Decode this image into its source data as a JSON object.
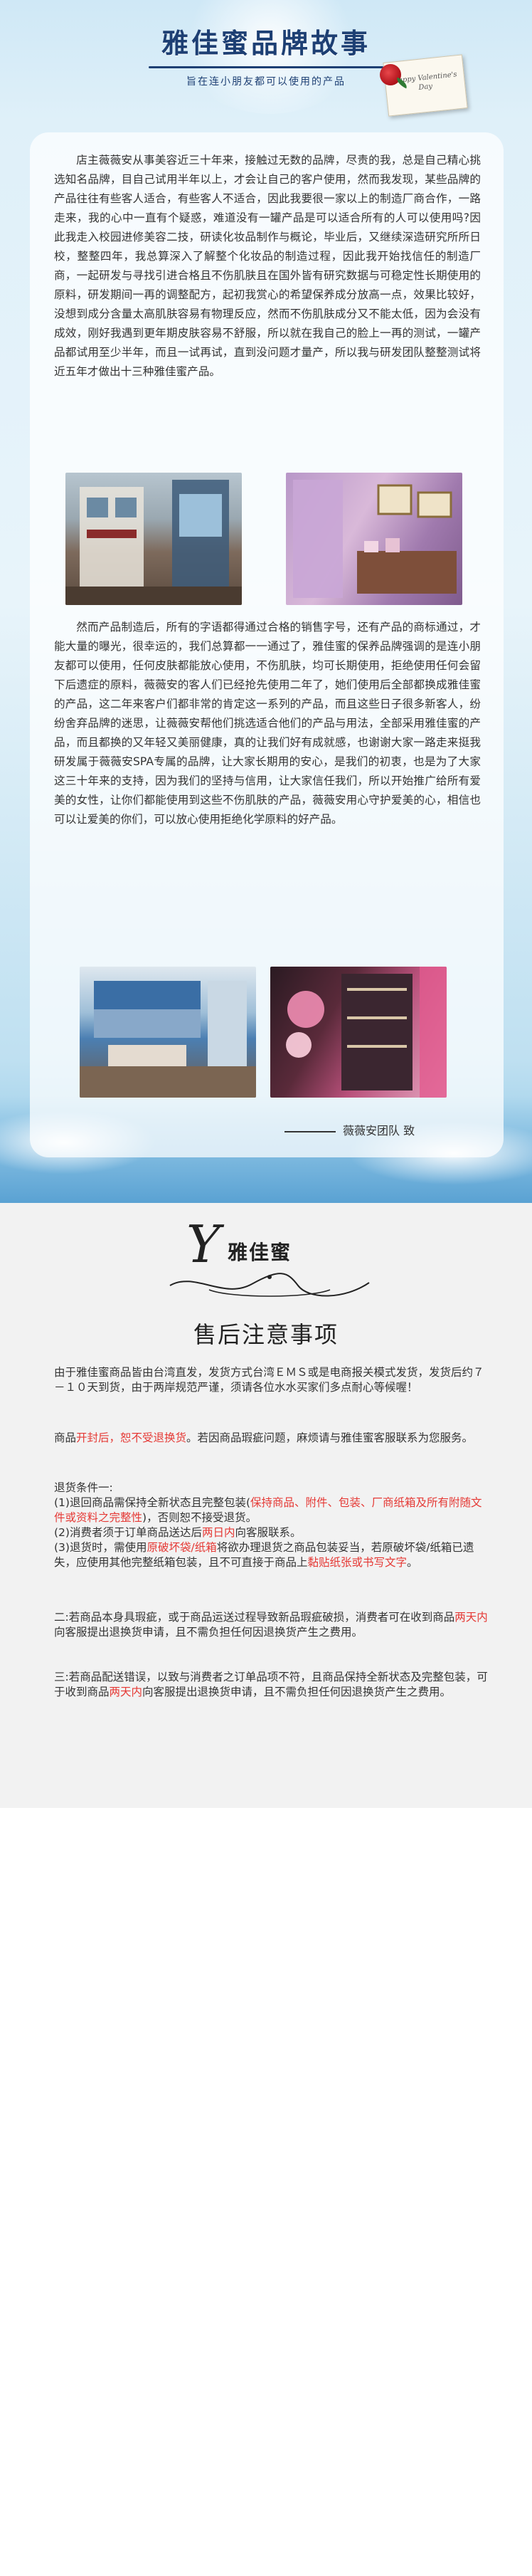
{
  "story": {
    "title": "雅佳蜜品牌故事",
    "subtitle": "旨在连小朋友都可以使用的产品",
    "card_text": "Happy Valentine's Day",
    "paragraph1": "店主薇薇安从事美容近三十年来，接触过无数的品牌，尽责的我，总是自己精心挑选知名品牌，目自己试用半年以上，才会让自己的客户使用，然而我发现，某些品牌的产品往往有些客人适合，有些客人不适合，因此我要很一家以上的制造厂商合作，一路走来，我的心中一直有个疑惑，难道没有一罐产品是可以适合所有的人可以使用吗?因此我走入校园进修美容二技，研读化妆品制作与概论，毕业后，又继续深造研究所所日校，整整四年，我总算深入了解整个化妆品的制造过程，因此我开始找信任的制造厂商，一起研发与寻找引进合格且不伤肌肤且在国外皆有研究数据与可稳定性长期使用的原料，研发期间一再的调整配方，起初我赏心的希望保养成分放高一点，效果比较好，没想到成分含量太高肌肤容易有物理反应，然而不伤肌肤成分又不能太低，因为会没有成效，刚好我遇到更年期皮肤容易不舒服，所以就在我自己的脸上一再的测试，一罐产品都试用至少半年，而且一试再试，直到没问题才量产，所以我与研发团队整整测试将近五年才做出十三种雅佳蜜产品。",
    "paragraph2": "然而产品制造后，所有的字语都得通过合格的销售字号，还有产品的商标通过，才能大量的曝光，很幸运的，我们总算都一一通过了，雅佳蜜的保养品牌强调的是连小朋友都可以使用，任何皮肤都能放心使用，不伤肌肤，均可长期使用，拒绝使用任何会留下后遗症的原料，薇薇安的客人们已经抢先使用二年了，她们使用后全部都换成雅佳蜜的产品，这二年来客户们都非常的肯定这一系列的产品，而且这些日子很多新客人，纷纷舍弃品牌的迷思，让薇薇安帮他们挑选适合他们的产品与用法，全部采用雅佳蜜的产品，而且都换的又年轻又美丽健康，真的让我们好有成就感，也谢谢大家一路走来挺我研发属于薇薇安SPA专属的品牌，让大家长期用的安心，是我们的初衷，也是为了大家这三十年来的支持，因为我们的坚持与信用，让大家信任我们，所以开始推广给所有爱美的女性，让你们都能使用到这些不伤肌肤的产品，薇薇安用心守护爱美的心，相信也可以让爱美的你们，可以放心使用拒绝化学原料的好产品。",
    "signature": "薇薇安团队 致"
  },
  "notice": {
    "logo_letter": "Y",
    "logo_name": "雅佳蜜",
    "title": "售后注意事项",
    "intro": "由于雅佳蜜商品皆由台湾直发，发货方式台湾ＥＭＳ或是电商报关模式发货，发货后约７－１０天到货，由于两岸规范严谨，须请各位水水买家们多点耐心等候喔！",
    "opened_prefix": "商品",
    "opened_red": "开封后，恕不受退换货",
    "opened_suffix": "。若因商品瑕疵问题，麻烦请与雅佳蜜客服联系为您服务。",
    "conditions_heading": "退货条件一:",
    "cond1_prefix": "(1)退回商品需保持全新状态且完整包装(",
    "cond1_red": "保持商品、附件、包装、厂商纸箱及所有附随文件或资料之完整性",
    "cond1_suffix": ")，否则恕不接受退货。",
    "cond2_prefix": "(2)消费者须于订单商品送达后",
    "cond2_red": "两日内",
    "cond2_suffix": "向客服联系。",
    "cond3_prefix": "(3)退货时，需使用",
    "cond3_red1": "原破坏袋/纸箱",
    "cond3_mid": "将欲办理退货之商品包装妥当，若原破坏袋/纸箱已遗失，应使用其他完整纸箱包装，且不可直接于商品上",
    "cond3_red2": "黏贴纸张或书写文字",
    "cond3_suffix": "。",
    "sec2_prefix": "二:若商品本身具瑕疵，或于商品运送过程导致新品瑕疵破损，消费者可在收到商品",
    "sec2_red": "两天内",
    "sec2_suffix": "向客服提出退换货申请，且不需负担任何因退换货产生之费用。",
    "sec3_prefix": "三:若商品配送错误，以致与消费者之订单品项不符，且商品保持全新状态及完整包装，可于收到商品",
    "sec3_red": "两天内",
    "sec3_suffix": "向客服提出退换货申请，且不需负担任何因退换货产生之费用。"
  }
}
